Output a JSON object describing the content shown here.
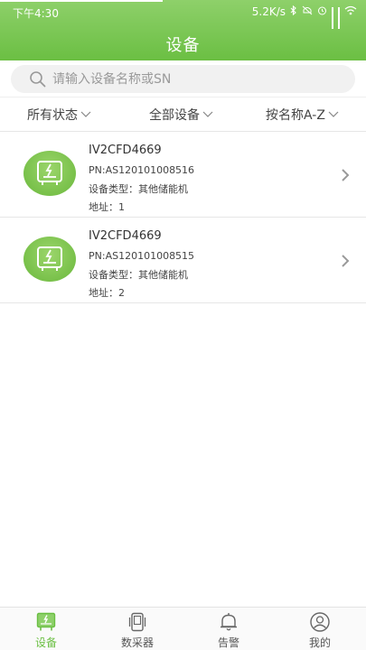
{
  "status_bar": {
    "time": "下午4:30",
    "network_speed": "5.2K/s",
    "icons": [
      "bluetooth-icon",
      "mute-icon",
      "alarm-icon",
      "signal-icon",
      "signal-icon",
      "wifi-icon"
    ]
  },
  "header": {
    "title": "设备"
  },
  "search": {
    "placeholder": "请输入设备名称或SN",
    "value": ""
  },
  "filters": [
    {
      "label": "所有状态"
    },
    {
      "label": "全部设备"
    },
    {
      "label": "按名称A-Z"
    }
  ],
  "devices": [
    {
      "name": "IV2CFD4669",
      "pn": "PN:AS120101008516",
      "type": "设备类型：其他储能机",
      "address": "地址：1"
    },
    {
      "name": "IV2CFD4669",
      "pn": "PN:AS120101008515",
      "type": "设备类型：其他储能机",
      "address": "地址：2"
    }
  ],
  "tabbar": [
    {
      "label": "设备",
      "icon": "device-icon",
      "active": true
    },
    {
      "label": "数采器",
      "icon": "collector-icon",
      "active": false
    },
    {
      "label": "告警",
      "icon": "bell-icon",
      "active": false
    },
    {
      "label": "我的",
      "icon": "user-icon",
      "active": false
    }
  ],
  "colors": {
    "brand": "#6bbf43",
    "brand_light": "#8ed06a"
  }
}
